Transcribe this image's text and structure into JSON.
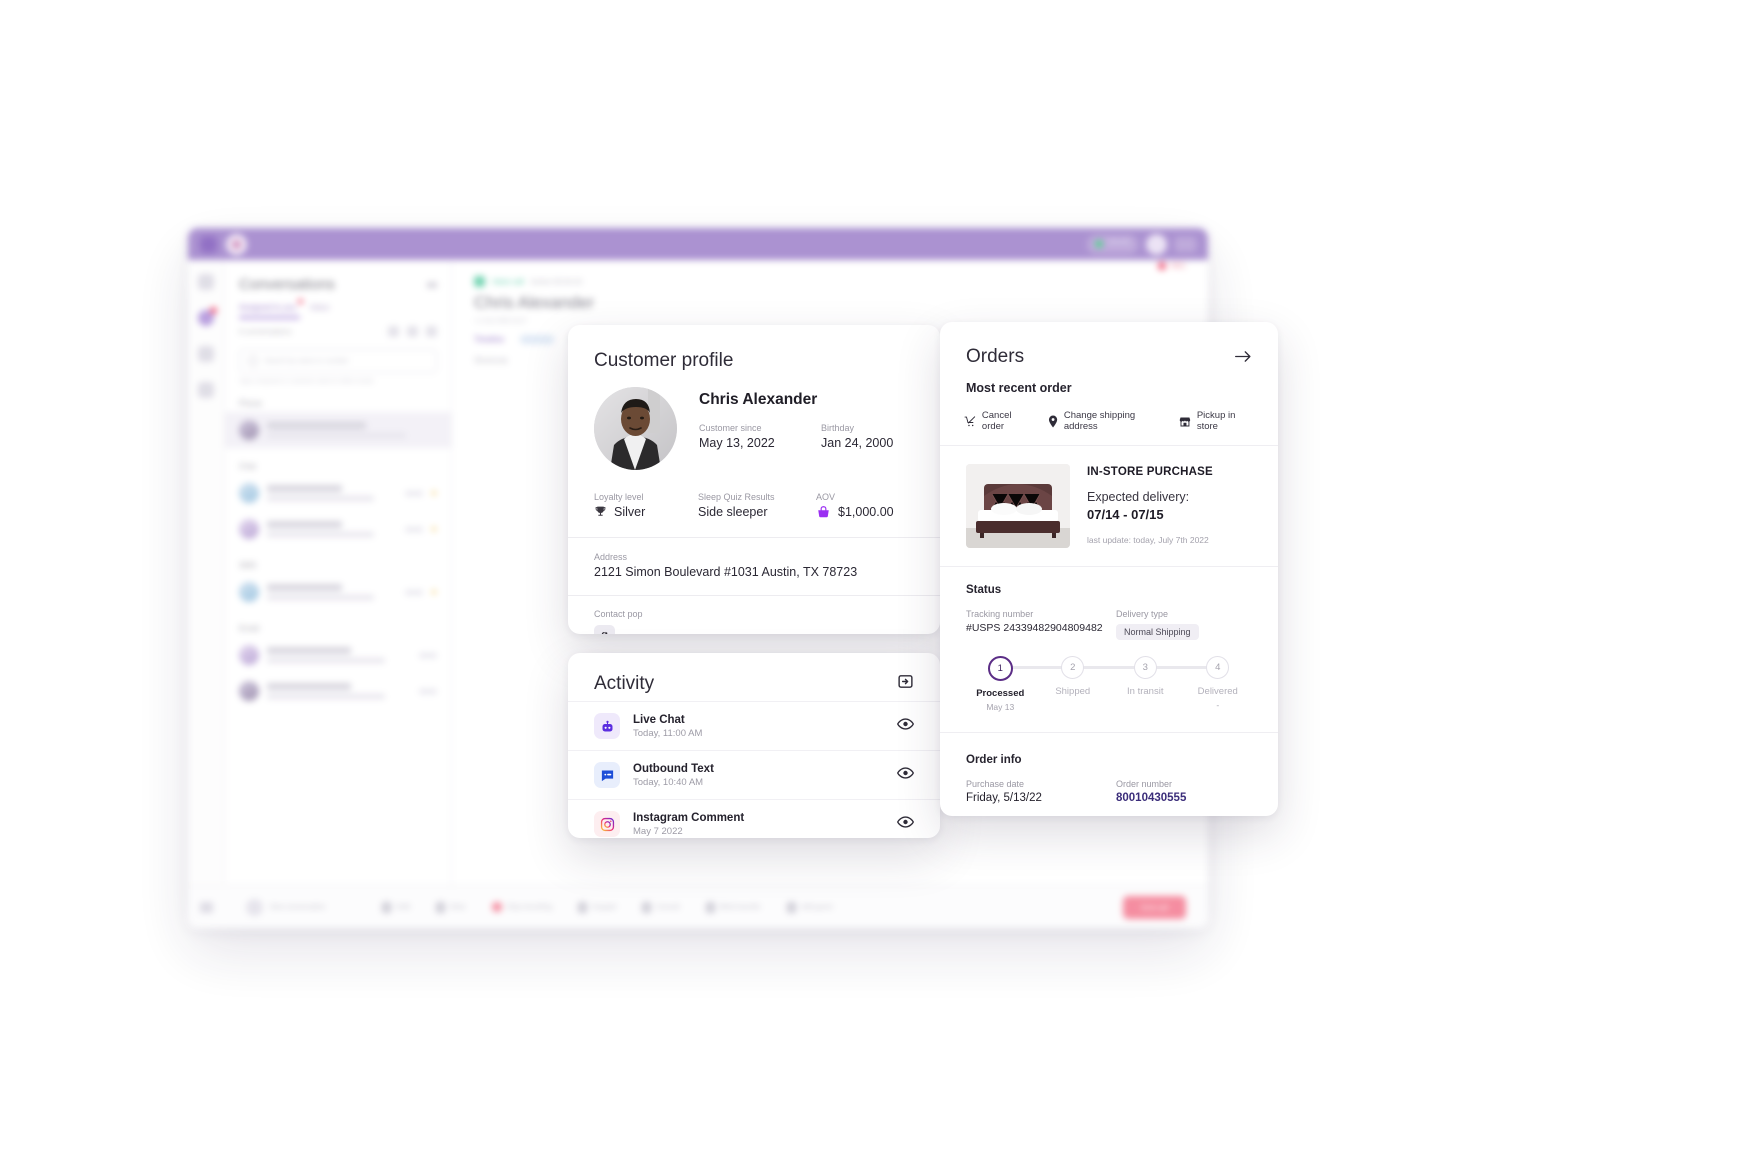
{
  "app": {
    "titlebar": {
      "status_label": "ONLINE",
      "status_sub": "Available"
    },
    "sidebar": {
      "title": "Conversations",
      "tabs": [
        {
          "label": "Assigned to you",
          "active": true
        },
        {
          "label": "Inbox",
          "active": false
        }
      ],
      "count_label": "6 conversations",
      "search_placeholder": "Search by name or number",
      "search_hint": "Type a keyword or customer name to refine results",
      "groups": [
        {
          "label": "Phone",
          "items": [
            {
              "name": "Chris Alexander",
              "preview": "Incoming voice call",
              "time": "",
              "selected": true,
              "starred": false
            }
          ]
        },
        {
          "label": "Chat",
          "items": [
            {
              "name": "Zhu Chen",
              "preview": "Hello, I need help with my order",
              "time": "11:02 AM",
              "selected": false,
              "starred": true
            },
            {
              "name": "Amber Smith",
              "preview": "When can I be called back?",
              "time": "10:51 AM",
              "selected": false,
              "starred": true
            }
          ]
        },
        {
          "label": "SMS",
          "items": [
            {
              "name": "Esther Alejandra Minor",
              "preview": "Hi! My order has not arrived yet",
              "time": "10:23 AM",
              "selected": false,
              "starred": true
            }
          ]
        },
        {
          "label": "Email",
          "items": [
            {
              "name": "Marquita Wright",
              "preview": "Refund status",
              "time": "9:58 AM",
              "selected": false,
              "starred": false
            },
            {
              "name": "ashleigh.chaudhury@gmail.com",
              "preview": "Tracking number inquiry",
              "time": "9:40 AM",
              "selected": false,
              "starred": false
            }
          ]
        }
      ]
    },
    "main": {
      "channel_label": "Voice call",
      "channel_meta": "Active 00:04:32",
      "customer_name": "Chris Alexander",
      "customer_sub": "+1 512 555 0127",
      "record_label": "REC",
      "tabs": [
        {
          "label": "Timeline",
          "active": true
        },
        {
          "label": "Cases",
          "active": false
        },
        {
          "label": "Notes",
          "active": false
        }
      ],
      "shortcuts_label": "Shortcuts"
    },
    "bottombar": {
      "new_conversation": "New conversation",
      "actions": [
        {
          "label": "Hold"
        },
        {
          "label": "Mute"
        },
        {
          "label": "Stop recording"
        },
        {
          "label": "Keypad"
        },
        {
          "label": "Consult"
        },
        {
          "label": "Blind transfer"
        },
        {
          "label": "Add guest"
        }
      ],
      "end_call": "End call"
    }
  },
  "profile": {
    "title": "Customer profile",
    "name": "Chris Alexander",
    "fields": {
      "customer_since_label": "Customer since",
      "customer_since_value": "May 13, 2022",
      "birthday_label": "Birthday",
      "birthday_value": "Jan 24, 2000",
      "loyalty_label": "Loyalty level",
      "loyalty_value": "Silver",
      "sleep_quiz_label": "Sleep Quiz Results",
      "sleep_quiz_value": "Side sleeper",
      "aov_label": "AOV",
      "aov_value": "$1,000.00",
      "address_label": "Address",
      "address_value": "2121 Simon Boulevard #1031 Austin, TX 78723",
      "contact_pop_label": "Contact pop"
    }
  },
  "activity": {
    "title": "Activity",
    "items": [
      {
        "name": "Live Chat",
        "time": "Today, 11:00 AM",
        "icon": "live-chat-icon"
      },
      {
        "name": "Outbound Text",
        "time": "Today, 10:40 AM",
        "icon": "outbound-text-icon"
      },
      {
        "name": "Instagram Comment",
        "time": "May 7 2022",
        "icon": "instagram-icon"
      }
    ]
  },
  "orders": {
    "title": "Orders",
    "subtitle": "Most recent order",
    "actions": [
      {
        "label": "Cancel order",
        "icon": "cancel-cart-icon"
      },
      {
        "label": "Change shipping address",
        "icon": "location-pin-icon"
      },
      {
        "label": "Pickup in store",
        "icon": "store-icon"
      }
    ],
    "product": {
      "purchase_type": "IN-STORE PURCHASE",
      "expected_label": "Expected delivery:",
      "expected_range": "07/14 - 07/15",
      "last_update": "last update: today, July 7th 2022"
    },
    "status": {
      "section_title": "Status",
      "tracking_label": "Tracking number",
      "tracking_value": "#USPS 24339482904809482",
      "delivery_label": "Delivery type",
      "delivery_value": "Normal Shipping",
      "steps": [
        {
          "num": "1",
          "label": "Processed",
          "date": "May 13",
          "done": true
        },
        {
          "num": "2",
          "label": "Shipped",
          "date": "",
          "done": false
        },
        {
          "num": "3",
          "label": "In transit",
          "date": "",
          "done": false
        },
        {
          "num": "4",
          "label": "Delivered",
          "date": "-",
          "done": false
        }
      ]
    },
    "info": {
      "section_title": "Order info",
      "purchase_date_label": "Purchase date",
      "purchase_date_value": "Friday, 5/13/22",
      "order_number_label": "Order number",
      "order_number_value": "80010430555"
    }
  },
  "colors": {
    "brand_purple": "#a98fd0",
    "accent_purple": "#5b2d86",
    "link_blue": "#3b2d7a",
    "danger": "#f58a9e",
    "online_green": "#4fd38a"
  }
}
